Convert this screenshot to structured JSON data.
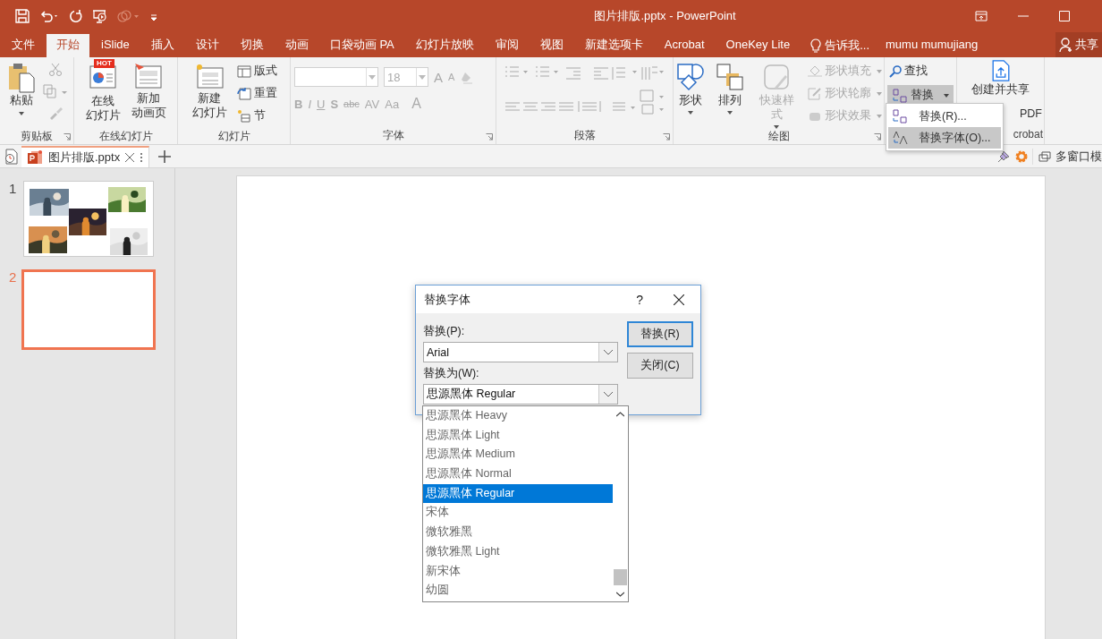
{
  "window": {
    "title": "图片排版.pptx - PowerPoint"
  },
  "ribbon_tabs": [
    {
      "label": "文件",
      "selected": false
    },
    {
      "label": "开始",
      "selected": true
    },
    {
      "label": "iSlide",
      "selected": false
    },
    {
      "label": "插入",
      "selected": false
    },
    {
      "label": "设计",
      "selected": false
    },
    {
      "label": "切换",
      "selected": false
    },
    {
      "label": "动画",
      "selected": false
    },
    {
      "label": "口袋动画 PA",
      "selected": false
    },
    {
      "label": "幻灯片放映",
      "selected": false
    },
    {
      "label": "审阅",
      "selected": false
    },
    {
      "label": "视图",
      "selected": false
    },
    {
      "label": "新建选项卡",
      "selected": false
    },
    {
      "label": "Acrobat",
      "selected": false
    },
    {
      "label": "OneKey Lite",
      "selected": false
    }
  ],
  "tell_me": "告诉我...",
  "user": "mumu mumujiang",
  "share_button": "共享",
  "clipboard": {
    "paste": "粘贴",
    "group": "剪贴板"
  },
  "online_slides": {
    "hot_badge": "HOT",
    "items": [
      [
        "在线",
        "幻灯片"
      ],
      [
        "新加",
        "动画页"
      ]
    ],
    "group": "在线幻灯片"
  },
  "slides_group": {
    "new_slide": [
      "新建",
      "幻灯片"
    ],
    "small": [
      "版式",
      "重置",
      "节"
    ],
    "group": "幻灯片"
  },
  "font": {
    "font_size": "18",
    "size_glyphs": [
      "A",
      "A"
    ],
    "format_glyphs": [
      "B",
      "I",
      "U",
      "S",
      "abc",
      "AV",
      "Aa",
      "A"
    ],
    "group": "字体"
  },
  "paragraph": {
    "group": "段落"
  },
  "drawing": {
    "large": [
      {
        "label": "形状",
        "disabled": false
      },
      {
        "label": "排列",
        "disabled": false
      },
      {
        "label": "快速样式",
        "disabled": true
      }
    ],
    "small": [
      {
        "label": "形状填充",
        "disabled": true
      },
      {
        "label": "形状轮廓",
        "disabled": true
      },
      {
        "label": "形状效果",
        "disabled": true
      }
    ],
    "group": "绘图"
  },
  "editing": {
    "find": "查找",
    "replace": {
      "label": "替换",
      "expanded": true
    }
  },
  "acrobat": {
    "create": "创建并共享",
    "pdf": "PDF",
    "group": "crobat"
  },
  "replace_menu": [
    {
      "label": "替换(R)...",
      "selected": false
    },
    {
      "label": "替换字体(O)...",
      "selected": true
    }
  ],
  "doc_tabs": [
    {
      "label": "图片排版.pptx",
      "selected": true
    }
  ],
  "multi_window": "多窗口模",
  "slides": [
    {
      "number": "1",
      "selected": false,
      "kind": "photos"
    },
    {
      "number": "2",
      "selected": true,
      "kind": "blank"
    }
  ],
  "dialog": {
    "title": "替换字体",
    "help": "?",
    "replace_label": "替换(P):",
    "replace_value": "Arial",
    "with_label": "替换为(W):",
    "with_value": "思源黑体 Regular",
    "buttons": [
      {
        "label": "替换(R)",
        "default": true
      },
      {
        "label": "关闭(C)",
        "default": false
      }
    ]
  },
  "font_list": [
    {
      "label": "思源黑体 Heavy",
      "selected": false
    },
    {
      "label": "思源黑体 Light",
      "selected": false
    },
    {
      "label": "思源黑体 Medium",
      "selected": false
    },
    {
      "label": "思源黑体 Normal",
      "selected": false
    },
    {
      "label": "思源黑体 Regular",
      "selected": true
    },
    {
      "label": "宋体",
      "selected": false
    },
    {
      "label": "微软雅黑",
      "selected": false
    },
    {
      "label": "微软雅黑 Light",
      "selected": false
    },
    {
      "label": "新宋体",
      "selected": false
    },
    {
      "label": "幼圆",
      "selected": false
    }
  ]
}
